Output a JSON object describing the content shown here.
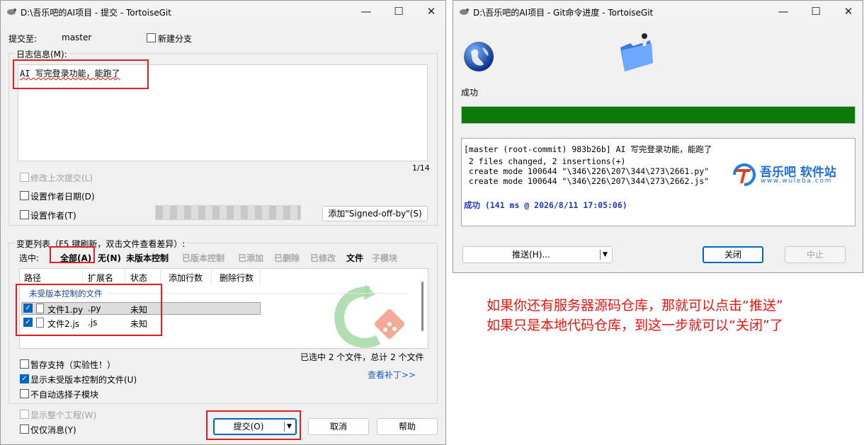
{
  "commit_dialog": {
    "title": "D:\\吾乐吧的AI项目 - 提交 - TortoiseGit",
    "commit_to_label": "提交至:",
    "branch": "master",
    "new_branch_label": "新建分支",
    "log_message_label": "日志信息(M):",
    "log_message": "AI 写完登录功能，能跑了",
    "char_count": "1/14",
    "amend_label": "修改上次提交(L)",
    "set_author_date_label": "设置作者日期(D)",
    "set_author_label": "设置作者(T)",
    "signed_off_button": "添加\"Signed-off-by\"(S)",
    "changes_label": "变更列表（F5 键刷新，双击文件查看差异）:",
    "select_label": "选中:",
    "filters": {
      "all": "全部(A)",
      "none": "无(N)",
      "unversioned": "未版本控制",
      "versioned": "已版本控制",
      "added": "已添加",
      "deleted": "已删除",
      "modified": "已修改",
      "files": "文件",
      "submodules": "子模块"
    },
    "columns": {
      "path": "路径",
      "ext": "扩展名",
      "status": "状态",
      "lines_added": "添加行数",
      "lines_removed": "删除行数"
    },
    "group_header": "未受版本控制的文件",
    "files": [
      {
        "name": "文件1.py",
        "ext": ".py",
        "status": "未知"
      },
      {
        "name": "文件2.js",
        "ext": ".js",
        "status": "未知"
      }
    ],
    "selection_summary": "已选中 2 个文件，总计 2 个文件",
    "view_patch_link": "查看补丁>>",
    "stash_support_label": "暂存支持（实验性！）",
    "show_unversioned_label": "显示未受版本控制的文件(U)",
    "no_auto_submodule_label": "不自动选择子模块",
    "show_whole_project_label": "显示整个工程(W)",
    "message_only_label": "仅仅消息(Y)",
    "commit_button": "提交(O)",
    "cancel_button": "取消",
    "help_button": "帮助"
  },
  "progress_dialog": {
    "title": "D:\\吾乐吧的AI项目 - Git命令进度 - TortoiseGit",
    "status": "成功",
    "progress_percent": 100,
    "output_lines": [
      "[master (root-commit) 983b26b] AI 写完登录功能，能跑了",
      " 2 files changed, 2 insertions(+)",
      " create mode 100644 \"\\346\\226\\207\\344\\273\\2661.py\"",
      " create mode 100644 \"\\346\\226\\207\\344\\273\\2662.js\""
    ],
    "result_line": "成功 (141 ms @ 2026/8/11 17:05:06)",
    "watermark_name": "吾乐吧 软件站",
    "watermark_url": "www.wuleba.com",
    "push_button": "推送(H)...",
    "close_button": "关闭",
    "abort_button": "中止"
  },
  "annotation": {
    "line1": "如果你还有服务器源码仓库，那就可以点击“推送”",
    "line2": "如果只是本地代码仓库，到这一步就可以“关闭”了"
  },
  "colors": {
    "annotation_red": "#e8150f",
    "progress_green": "#0b7a0b",
    "accent_blue": "#0067c0",
    "highlight_red": "#e02020"
  },
  "icons": [
    "tortoisegit-icon",
    "minimize-icon",
    "maximize-icon",
    "close-icon",
    "document-icon",
    "checkmark-icon",
    "dropdown-arrow-icon",
    "globe-icon",
    "folder-icon",
    "tortoisegit-watermark-icon"
  ]
}
